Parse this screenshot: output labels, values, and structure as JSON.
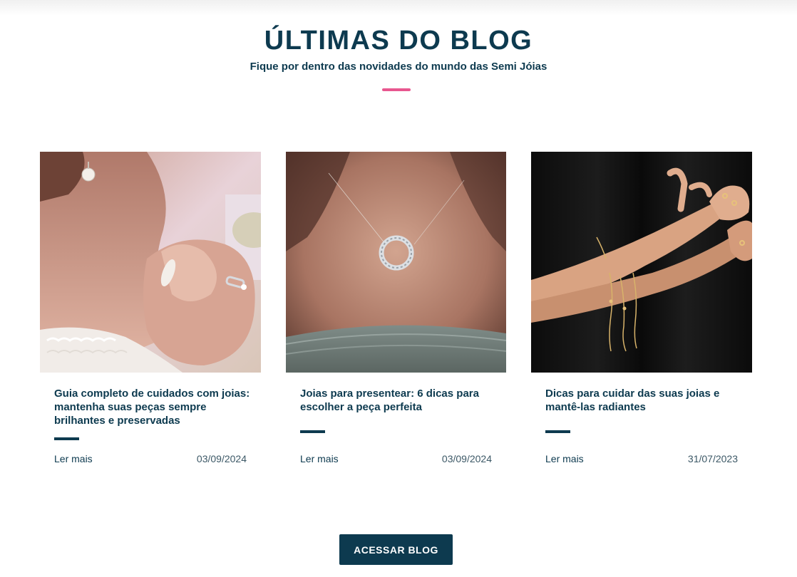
{
  "section": {
    "title": "ÚLTIMAS DO BLOG",
    "subtitle": "Fique por dentro das novidades do mundo das Semi Jóias",
    "accent_color": "#e8578f",
    "primary_color": "#0d3a4f"
  },
  "posts": [
    {
      "image": "woman-neck-ring-photo",
      "title": "Guia completo de cuidados com joias: mantenha suas peças sempre brilhantes e preservadas",
      "read_more": "Ler mais",
      "date": "03/09/2024"
    },
    {
      "image": "circle-pendant-necklace-photo",
      "title": "Joias para presentear: 6 dicas para escolher a peça perfeita",
      "read_more": "Ler mais",
      "date": "03/09/2024"
    },
    {
      "image": "arms-gold-bracelets-photo",
      "title": "Dicas para cuidar das suas joias e mantê-las radiantes",
      "read_more": "Ler mais",
      "date": "31/07/2023"
    }
  ],
  "cta": {
    "label": "ACESSAR BLOG"
  }
}
